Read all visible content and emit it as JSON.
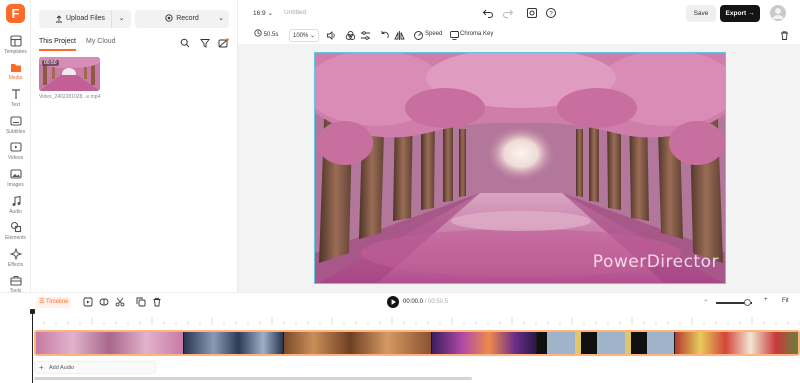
{
  "app": {
    "logo_letter": "F",
    "brand_color": "#ff6a2b"
  },
  "sidebar": {
    "items": [
      {
        "label": "Templates",
        "icon": "layout-icon"
      },
      {
        "label": "Media",
        "icon": "folder-icon",
        "active": true
      },
      {
        "label": "Text",
        "icon": "text-icon"
      },
      {
        "label": "Subtitles",
        "icon": "subtitles-icon"
      },
      {
        "label": "Videos",
        "icon": "video-icon"
      },
      {
        "label": "Images",
        "icon": "image-icon"
      },
      {
        "label": "Audio",
        "icon": "music-icon"
      },
      {
        "label": "Elements",
        "icon": "shapes-icon"
      },
      {
        "label": "Effects",
        "icon": "sparkle-icon"
      },
      {
        "label": "Tools",
        "icon": "toolbox-icon"
      }
    ]
  },
  "media_panel": {
    "upload_label": "Upload Files",
    "record_label": "Record",
    "tabs": [
      {
        "label": "This Project",
        "active": true
      },
      {
        "label": "My Cloud",
        "active": false
      }
    ],
    "items": [
      {
        "duration": "00:50",
        "filename": "Video_2402281028...e.mp4"
      }
    ]
  },
  "topbar": {
    "aspect_ratio": "16:9",
    "project_title": "Untitled",
    "save_label": "Save",
    "export_label": "Export"
  },
  "toolbar": {
    "duration": "50.5s",
    "zoom": "100%",
    "speed_label": "Speed",
    "chroma_label": "Chroma Key"
  },
  "preview": {
    "watermark": "PowerDirector"
  },
  "timeline": {
    "tab_label": "Timeline",
    "current_time": "00:00.0",
    "total_time": "/ 00:50.5",
    "fit_label": "Fit",
    "add_audio_label": "Add Audio",
    "zoom_level": 0.85
  }
}
